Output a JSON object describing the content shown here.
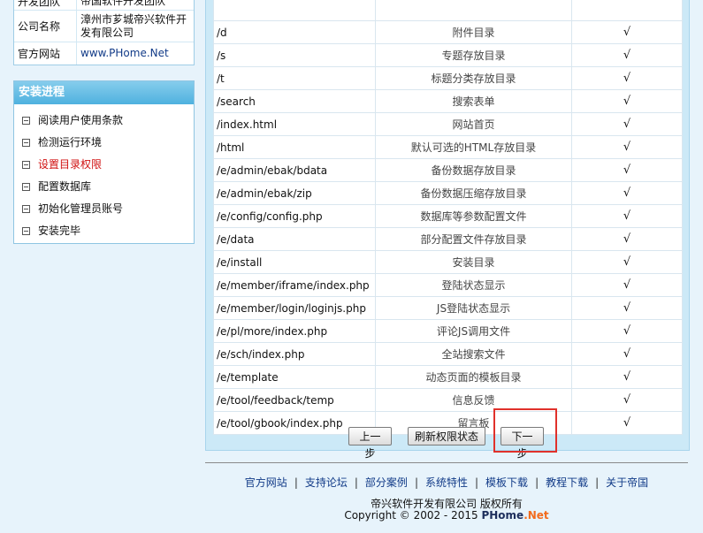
{
  "company_info": {
    "developer": {
      "label": "开发团队",
      "value": "帝国软件开发团队"
    },
    "company": {
      "label": "公司名称",
      "value": "漳州市芗城帝兴软件开发有限公司"
    },
    "website": {
      "label": "官方网站",
      "value": "www.PHome.Net"
    }
  },
  "progress": {
    "title": "安装进程",
    "steps": [
      {
        "label": "阅读用户使用条款",
        "current": false
      },
      {
        "label": "检测运行环境",
        "current": false
      },
      {
        "label": "设置目录权限",
        "current": true
      },
      {
        "label": "配置数据库",
        "current": false
      },
      {
        "label": "初始化管理员账号",
        "current": false
      },
      {
        "label": "安装完毕",
        "current": false
      }
    ]
  },
  "permissions": {
    "check_mark": "√",
    "rows": [
      {
        "path": "",
        "desc": ""
      },
      {
        "path": "/d",
        "desc": "附件目录"
      },
      {
        "path": "/s",
        "desc": "专题存放目录"
      },
      {
        "path": "/t",
        "desc": "标题分类存放目录"
      },
      {
        "path": "/search",
        "desc": "搜索表单"
      },
      {
        "path": "/index.html",
        "desc": "网站首页"
      },
      {
        "path": "/html",
        "desc": "默认可选的HTML存放目录"
      },
      {
        "path": "/e/admin/ebak/bdata",
        "desc": "备份数据存放目录"
      },
      {
        "path": "/e/admin/ebak/zip",
        "desc": "备份数据压缩存放目录"
      },
      {
        "path": "/e/config/config.php",
        "desc": "数据库等参数配置文件"
      },
      {
        "path": "/e/data",
        "desc": "部分配置文件存放目录"
      },
      {
        "path": "/e/install",
        "desc": "安装目录"
      },
      {
        "path": "/e/member/iframe/index.php",
        "desc": "登陆状态显示"
      },
      {
        "path": "/e/member/login/loginjs.php",
        "desc": "JS登陆状态显示"
      },
      {
        "path": "/e/pl/more/index.php",
        "desc": "评论JS调用文件"
      },
      {
        "path": "/e/sch/index.php",
        "desc": "全站搜索文件"
      },
      {
        "path": "/e/template",
        "desc": "动态页面的模板目录"
      },
      {
        "path": "/e/tool/feedback/temp",
        "desc": "信息反馈"
      },
      {
        "path": "/e/tool/gbook/index.php",
        "desc": "留言板"
      }
    ]
  },
  "buttons": {
    "prev": "上一步",
    "refresh": "刷新权限状态",
    "next": "下一步"
  },
  "footer": {
    "links": [
      "官方网站",
      "支持论坛",
      "部分案例",
      "系统特性",
      "模板下载",
      "教程下载",
      "关于帝国"
    ],
    "separator": "|",
    "company": "帝兴软件开发有限公司 版权所有",
    "copyright": "Copyright © 2002 - 2015",
    "brand": "PHome",
    "brand_suffix": ".Net"
  },
  "colors": {
    "page_bg": "#e7f3fb",
    "panel_bg": "#cce9f7",
    "header_blue": "#4fb1df",
    "current_step": "#d01010",
    "link": "#123b88",
    "highlight": "#e0312b",
    "brand_orange": "#f26b1d"
  }
}
